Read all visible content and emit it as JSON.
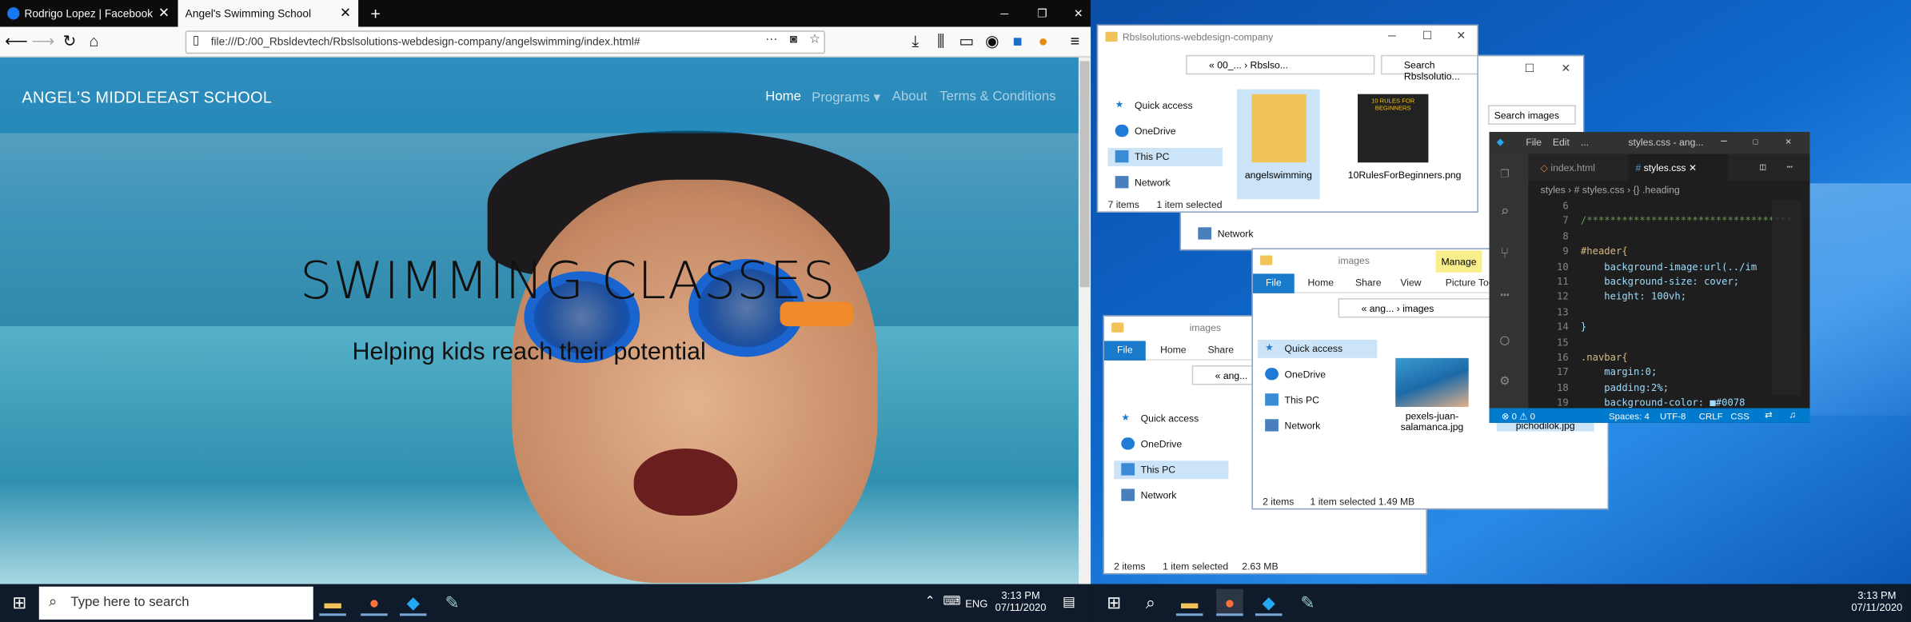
{
  "firefox": {
    "tabs": [
      {
        "label": "Rodrigo Lopez | Facebook"
      },
      {
        "label": "Angel's Swimming School"
      }
    ],
    "url": "file:///D:/00_Rbsldevtech/Rbslsolutions-webdesign-company/angelswimming/index.html#"
  },
  "site": {
    "brand": "ANGEL'S MIDDLEEAST SCHOOL",
    "nav": [
      "Home",
      "Programs",
      "About",
      "Terms & Conditions"
    ],
    "hero_title": "SWIMMING CLASSES",
    "hero_sub": "Helping kids reach their potential"
  },
  "taskbar": {
    "search_placeholder": "Type here to search",
    "lang": "ENG",
    "time": "3:13 PM",
    "date": "07/11/2020"
  },
  "explorer1": {
    "title": "Rbslsolutions-webdesign-company",
    "path": "« 00_... › Rbslso...",
    "search": "Search Rbslsolutio...",
    "nav": [
      "Quick access",
      "OneDrive",
      "This PC",
      "Network"
    ],
    "files": [
      "angelswimming",
      "10RulesForBeginners.png"
    ],
    "thumb_text": "10 RULES FOR BEGINNERS",
    "items": "7 items",
    "selected": "1 item selected"
  },
  "explorer_back": {
    "search": "Search images",
    "network": "Network"
  },
  "explorer2": {
    "title": "images",
    "manage": "Manage",
    "tabs": [
      "File",
      "Home",
      "Share",
      "View",
      "Picture Tools"
    ],
    "path": "« ang... › images",
    "nav": [
      "Quick access",
      "OneDrive",
      "This PC",
      "Network"
    ],
    "files": [
      "pexels-juan-salamanca.jpg",
      "pichodilok.jpg"
    ],
    "items": "2 items",
    "selected": "1 item selected",
    "size": "1.49 MB"
  },
  "explorer3": {
    "title": "images",
    "tabs": [
      "File",
      "Home",
      "Share"
    ],
    "path": "« ang...",
    "nav": [
      "Quick access",
      "OneDrive",
      "This PC",
      "Network"
    ],
    "items": "2 items",
    "selected": "1 item selected",
    "size": "2.63 MB"
  },
  "vscode": {
    "title": "styles.css - ang...",
    "menu": [
      "File",
      "Edit",
      "..."
    ],
    "tabs": [
      "index.html",
      "styles.css"
    ],
    "breadcrumb": "styles › # styles.css › {} .heading",
    "status": [
      "⊗ 0 ⚠ 0",
      "Spaces: 4",
      "UTF-8",
      "CRLF",
      "CSS"
    ],
    "lines": [
      {
        "n": "6",
        "t": ""
      },
      {
        "n": "7",
        "t": "/***********************************"
      },
      {
        "n": "8",
        "t": ""
      },
      {
        "n": "9",
        "t": "#header{"
      },
      {
        "n": "10",
        "t": "    background-image:url(../im"
      },
      {
        "n": "11",
        "t": "    background-size: cover;"
      },
      {
        "n": "12",
        "t": "    height: 100vh;"
      },
      {
        "n": "13",
        "t": ""
      },
      {
        "n": "14",
        "t": "}"
      },
      {
        "n": "15",
        "t": ""
      },
      {
        "n": "16",
        "t": ".navbar{"
      },
      {
        "n": "17",
        "t": "    margin:0;"
      },
      {
        "n": "18",
        "t": "    padding:2%;"
      },
      {
        "n": "19",
        "t": "    background-color: ■#0078"
      }
    ]
  }
}
